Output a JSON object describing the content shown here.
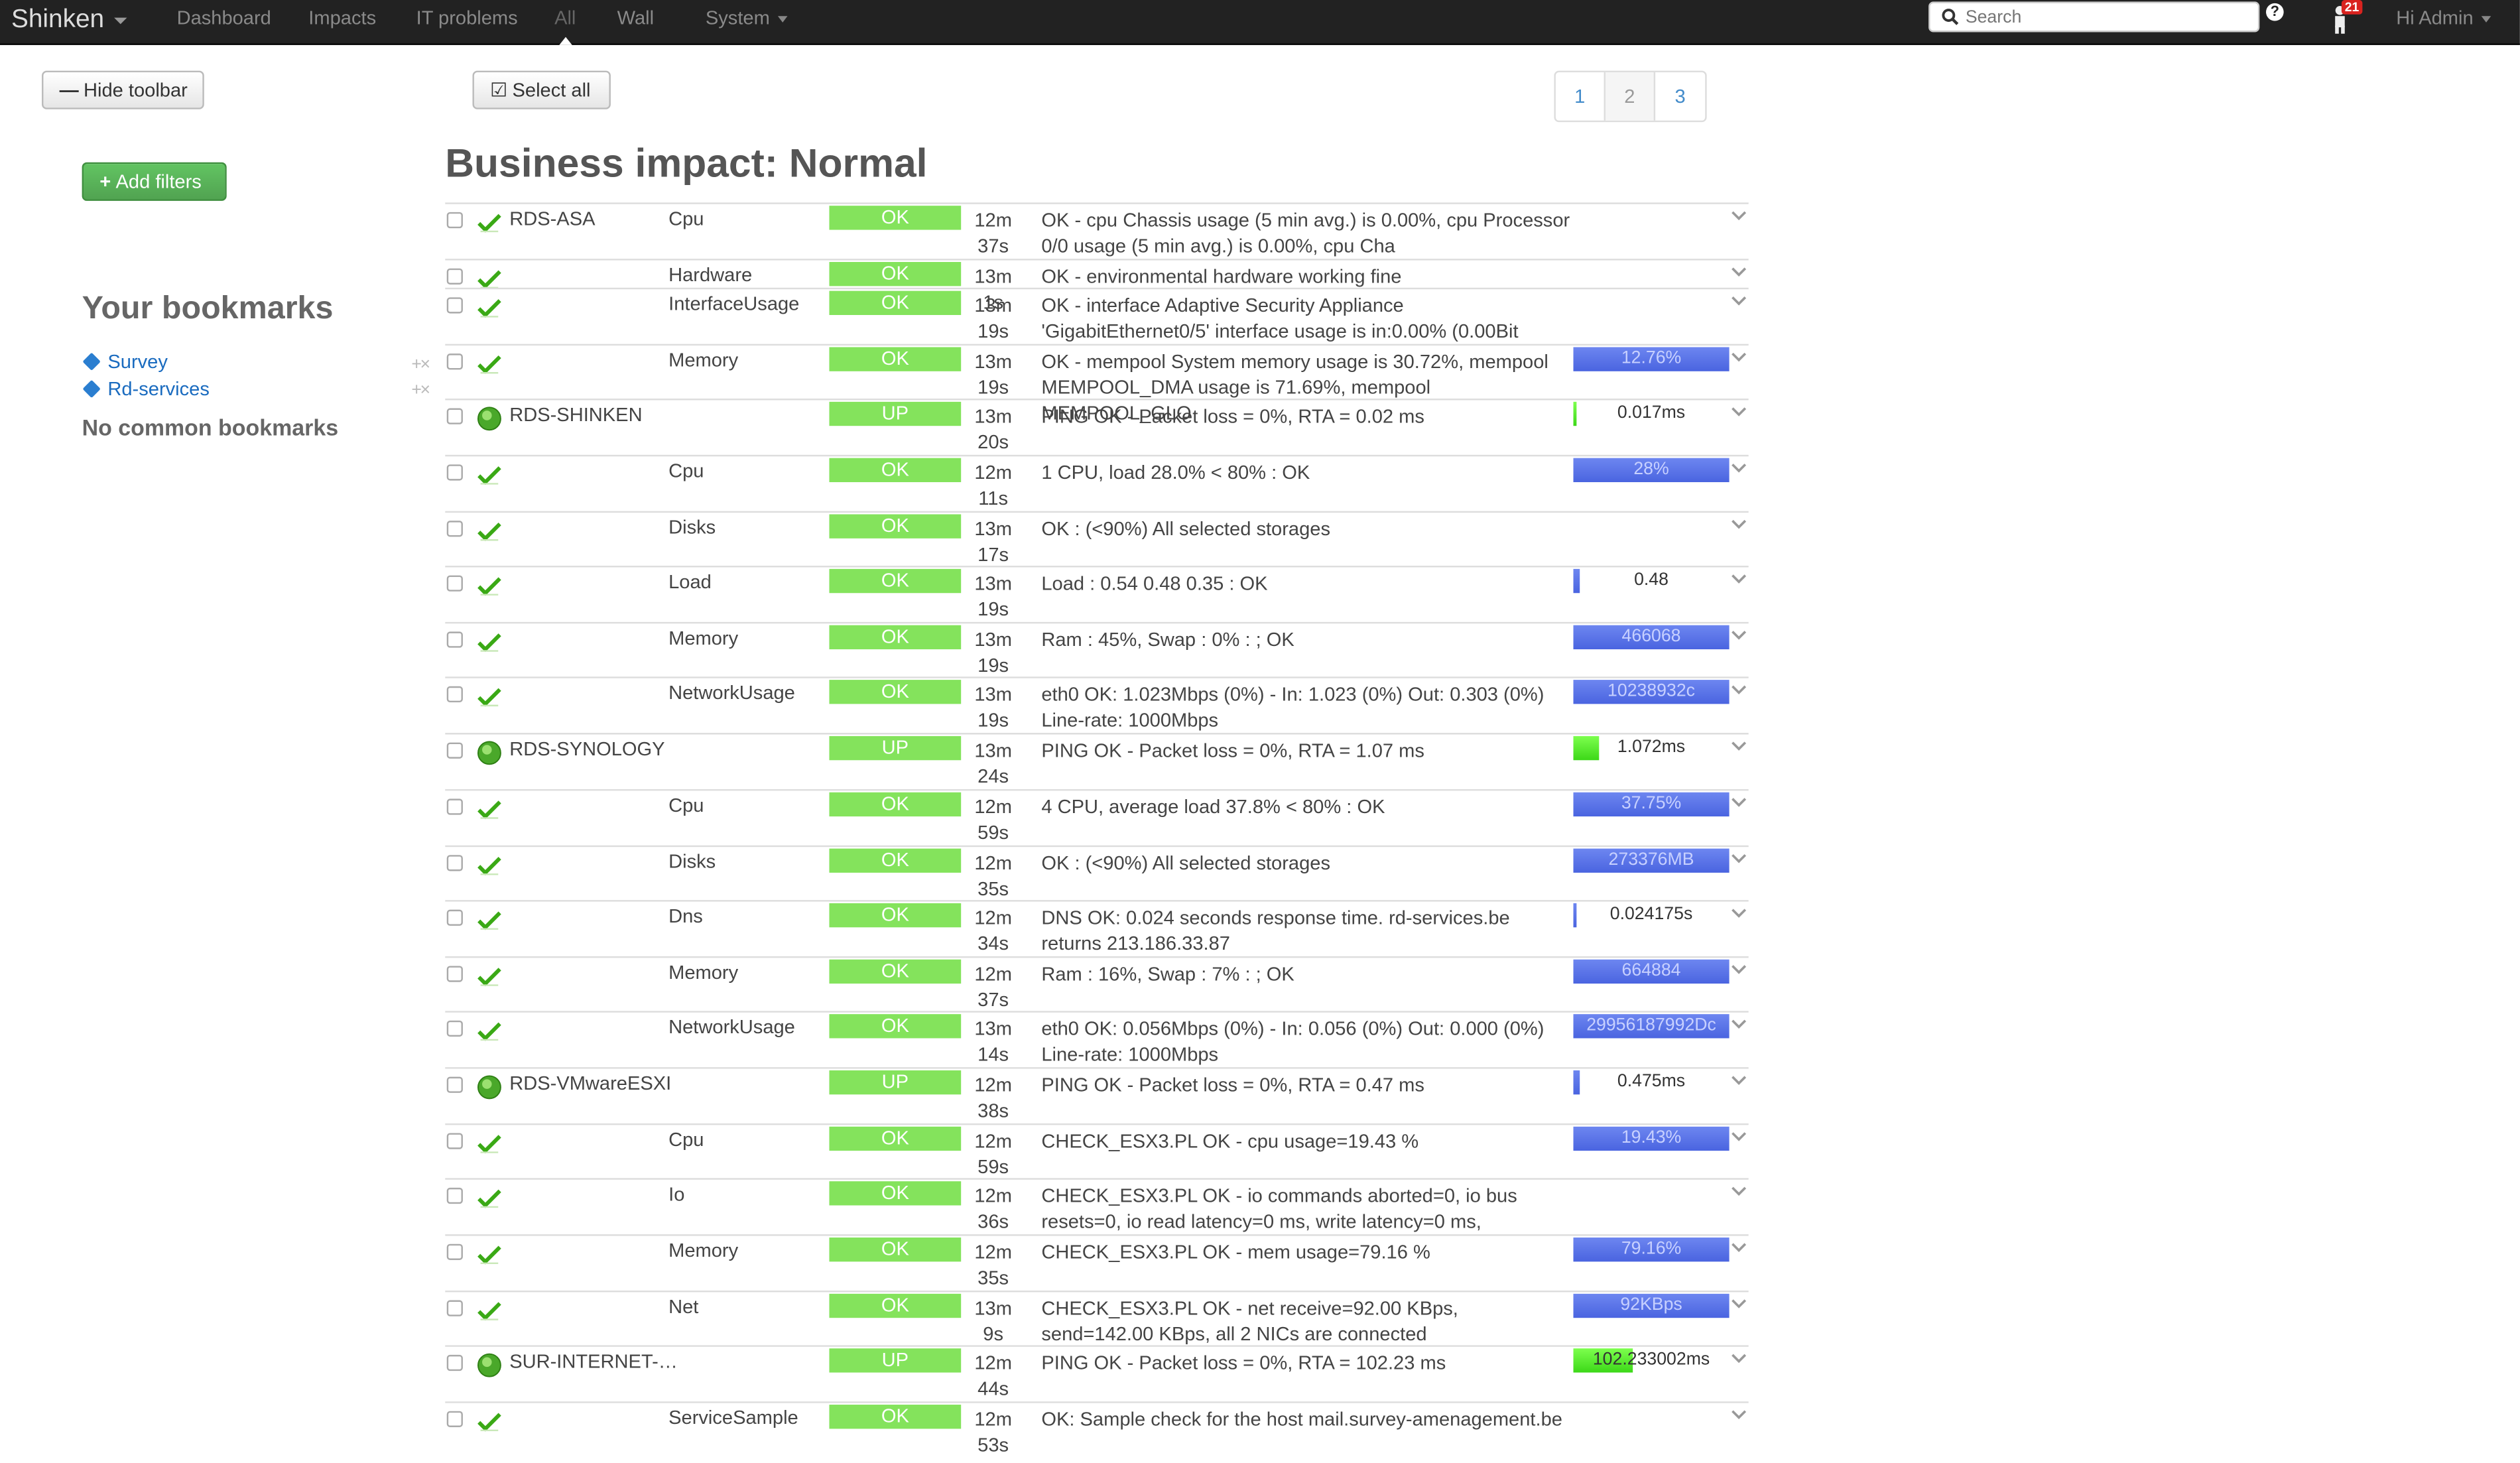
{
  "navbar": {
    "brand": "Shinken",
    "items": [
      "Dashboard",
      "Impacts",
      "IT problems",
      "All",
      "Wall"
    ],
    "system": "System",
    "search_placeholder": "Search",
    "help": "?",
    "notif_count": "21",
    "user": "Hi Admin"
  },
  "toolbar": {
    "hide_label": "Hide toolbar",
    "select_all_label": "Select all",
    "add_filters_label": "Add filters"
  },
  "pagination": [
    "1",
    "2",
    "3"
  ],
  "page_title": "Business impact: Normal",
  "bookmarks": {
    "heading": "Your bookmarks",
    "items": [
      "Survey",
      "Rd-services"
    ],
    "common": "No common bookmarks"
  },
  "rows": [
    {
      "host": "RDS-ASA",
      "service": "Cpu",
      "status": "OK",
      "duration": "12m 37s",
      "output": "OK - cpu Chassis usage (5 min avg.) is 0.00%, cpu Processor 0/0 usage (5 min avg.) is 0.00%, cpu Cha",
      "perf": ""
    },
    {
      "host": "",
      "service": "Hardware",
      "status": "OK",
      "duration": "13m 1s",
      "output": "OK - environmental hardware working fine",
      "perf": ""
    },
    {
      "host": "",
      "service": "InterfaceUsage",
      "status": "OK",
      "duration": "13m 19s",
      "output": "OK - interface Adaptive Security Appliance 'GigabitEthernet0/5' interface usage is in:0.00% (0.00Bit",
      "perf": ""
    },
    {
      "host": "",
      "service": "Memory",
      "status": "OK",
      "duration": "13m 19s",
      "output": "OK - mempool System memory usage is 30.72%, mempool MEMPOOL_DMA usage is 71.69%, mempool MEMPOOL_GLO",
      "perf": "12.76%"
    },
    {
      "host": "RDS-SHINKEN",
      "service": "",
      "status": "UP",
      "duration": "13m 20s",
      "output": "PING OK - Packet loss = 0%, RTA = 0.02 ms",
      "perf": "0.017ms"
    },
    {
      "host": "",
      "service": "Cpu",
      "status": "OK",
      "duration": "12m 11s",
      "output": "1 CPU, load 28.0% < 80% : OK",
      "perf": "28%"
    },
    {
      "host": "",
      "service": "Disks",
      "status": "OK",
      "duration": "13m 17s",
      "output": "OK : (<90%) All selected storages",
      "perf": ""
    },
    {
      "host": "",
      "service": "Load",
      "status": "OK",
      "duration": "13m 19s",
      "output": "Load : 0.54 0.48 0.35 : OK",
      "perf": "0.48"
    },
    {
      "host": "",
      "service": "Memory",
      "status": "OK",
      "duration": "13m 19s",
      "output": "Ram : 45%, Swap : 0% : ; OK",
      "perf": "466068"
    },
    {
      "host": "",
      "service": "NetworkUsage",
      "status": "OK",
      "duration": "13m 19s",
      "output": "eth0 OK: 1.023Mbps (0%) - In: 1.023 (0%) Out: 0.303 (0%) Line-rate: 1000Mbps",
      "perf": "10238932c"
    },
    {
      "host": "RDS-SYNOLOGY",
      "service": "",
      "status": "UP",
      "duration": "13m 24s",
      "output": "PING OK - Packet loss = 0%, RTA = 1.07 ms",
      "perf": "1.072ms"
    },
    {
      "host": "",
      "service": "Cpu",
      "status": "OK",
      "duration": "12m 59s",
      "output": "4 CPU, average load 37.8% < 80% : OK",
      "perf": "37.75%"
    },
    {
      "host": "",
      "service": "Disks",
      "status": "OK",
      "duration": "12m 35s",
      "output": "OK : (<90%) All selected storages",
      "perf": "273376MB"
    },
    {
      "host": "",
      "service": "Dns",
      "status": "OK",
      "duration": "12m 34s",
      "output": "DNS OK: 0.024 seconds response time. rd-services.be returns 213.186.33.87",
      "perf": "0.024175s"
    },
    {
      "host": "",
      "service": "Memory",
      "status": "OK",
      "duration": "12m 37s",
      "output": "Ram : 16%, Swap : 7% : ; OK",
      "perf": "664884"
    },
    {
      "host": "",
      "service": "NetworkUsage",
      "status": "OK",
      "duration": "13m 14s",
      "output": "eth0 OK: 0.056Mbps (0%) - In: 0.056 (0%) Out: 0.000 (0%) Line-rate: 1000Mbps",
      "perf": "29956187992Dc"
    },
    {
      "host": "RDS-VMwareESXI",
      "service": "",
      "status": "UP",
      "duration": "12m 38s",
      "output": "PING OK - Packet loss = 0%, RTA = 0.47 ms",
      "perf": "0.475ms"
    },
    {
      "host": "",
      "service": "Cpu",
      "status": "OK",
      "duration": "12m 59s",
      "output": "CHECK_ESX3.PL OK - cpu usage=19.43 %",
      "perf": "19.43%"
    },
    {
      "host": "",
      "service": "Io",
      "status": "OK",
      "duration": "12m 36s",
      "output": "CHECK_ESX3.PL OK - io commands aborted=0, io bus resets=0, io read latency=0 ms, write latency=0 ms,",
      "perf": ""
    },
    {
      "host": "",
      "service": "Memory",
      "status": "OK",
      "duration": "12m 35s",
      "output": "CHECK_ESX3.PL OK - mem usage=79.16 %",
      "perf": "79.16%"
    },
    {
      "host": "",
      "service": "Net",
      "status": "OK",
      "duration": "13m 9s",
      "output": "CHECK_ESX3.PL OK - net receive=92.00 KBps, send=142.00 KBps, all 2 NICs are connected",
      "perf": "92KBps"
    },
    {
      "host": "SUR-INTERNET-…",
      "service": "",
      "status": "UP",
      "duration": "12m 44s",
      "output": "PING OK - Packet loss = 0%, RTA = 102.23 ms",
      "perf": "102.233002ms"
    },
    {
      "host": "",
      "service": "ServiceSample",
      "status": "OK",
      "duration": "12m 53s",
      "output": "OK: Sample check for the host mail.survey-amenagement.be",
      "perf": ""
    }
  ],
  "perf_bars": {
    "3": {
      "fill": 1.0,
      "color": "blue"
    },
    "4": {
      "fill": 0.02,
      "color": "green"
    },
    "5": {
      "fill": 1.0,
      "color": "blue"
    },
    "7": {
      "fill": 0.04,
      "color": "blue"
    },
    "8": {
      "fill": 1.0,
      "color": "blue"
    },
    "9": {
      "fill": 1.0,
      "color": "blue"
    },
    "10": {
      "fill": 0.16,
      "color": "green"
    },
    "11": {
      "fill": 1.0,
      "color": "blue"
    },
    "12": {
      "fill": 1.0,
      "color": "blue"
    },
    "13": {
      "fill": 0.02,
      "color": "blue"
    },
    "14": {
      "fill": 1.0,
      "color": "blue"
    },
    "15": {
      "fill": 1.0,
      "color": "blue"
    },
    "16": {
      "fill": 0.04,
      "color": "blue"
    },
    "17": {
      "fill": 1.0,
      "color": "blue"
    },
    "19": {
      "fill": 1.0,
      "color": "blue"
    },
    "20": {
      "fill": 1.0,
      "color": "blue"
    },
    "21": {
      "fill": 0.38,
      "color": "green"
    }
  },
  "colors": {
    "navbar": "#222222",
    "ok": "#84e35c",
    "perf_blue": "#5a74e8",
    "perf_green": "#4ddf22",
    "link": "#1a6bbf",
    "success_button": "#5cb85c"
  }
}
